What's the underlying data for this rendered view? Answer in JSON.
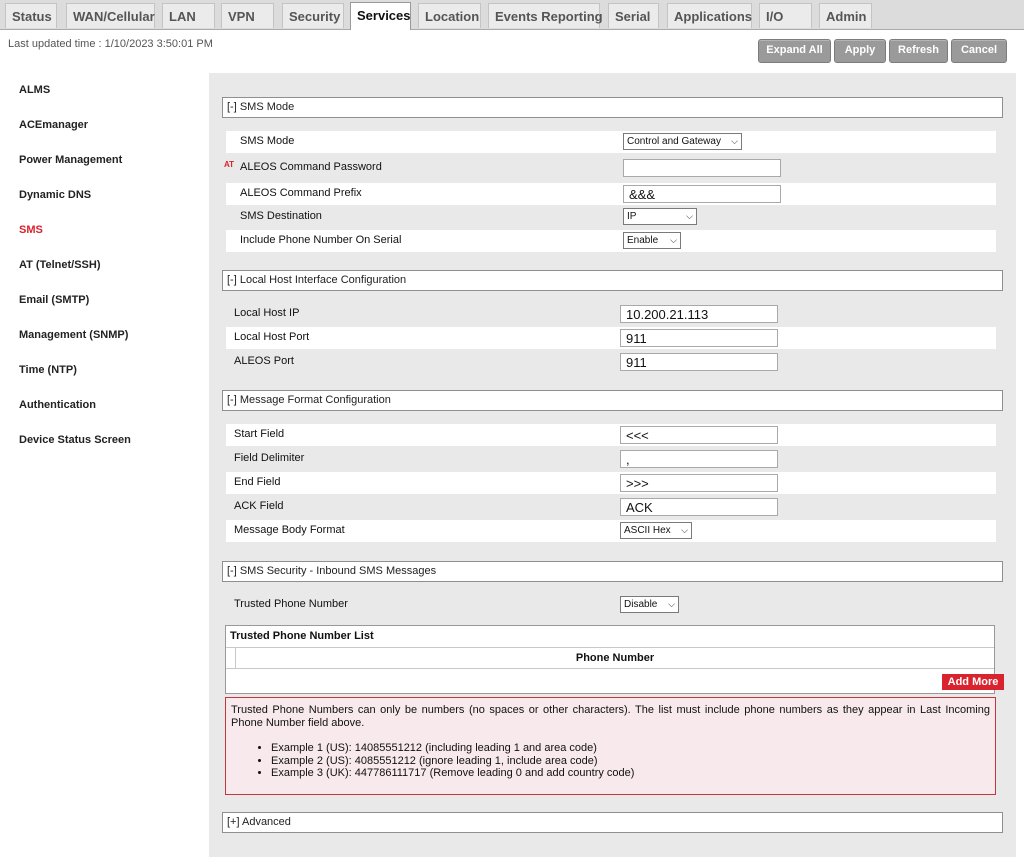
{
  "tabs": [
    {
      "label": "Status"
    },
    {
      "label": "WAN/Cellular"
    },
    {
      "label": "LAN"
    },
    {
      "label": "VPN"
    },
    {
      "label": "Security"
    },
    {
      "label": "Services"
    },
    {
      "label": "Location"
    },
    {
      "label": "Events Reporting"
    },
    {
      "label": "Serial"
    },
    {
      "label": "Applications"
    },
    {
      "label": "I/O"
    },
    {
      "label": "Admin"
    }
  ],
  "active_tab": "Services",
  "last_updated": "Last updated time : 1/10/2023 3:50:01 PM",
  "toolbar": {
    "expand_all": "Expand All",
    "apply": "Apply",
    "refresh": "Refresh",
    "cancel": "Cancel"
  },
  "sidebar": {
    "items": [
      {
        "label": "ALMS"
      },
      {
        "label": "ACEmanager"
      },
      {
        "label": "Power Management"
      },
      {
        "label": "Dynamic DNS"
      },
      {
        "label": "SMS"
      },
      {
        "label": "AT (Telnet/SSH)"
      },
      {
        "label": "Email (SMTP)"
      },
      {
        "label": "Management (SNMP)"
      },
      {
        "label": "Time (NTP)"
      },
      {
        "label": "Authentication"
      },
      {
        "label": "Device Status Screen"
      }
    ],
    "active": "SMS"
  },
  "sms_mode": {
    "header": "[-] SMS Mode",
    "at_marker": "AT",
    "rows": [
      {
        "label": "SMS Mode",
        "value": "Control and Gateway"
      },
      {
        "label": "ALEOS Command Password",
        "value": ""
      },
      {
        "label": "ALEOS Command Prefix",
        "value": "&&&"
      },
      {
        "label": "SMS Destination",
        "value": "IP"
      },
      {
        "label": "Include Phone Number On Serial",
        "value": "Enable"
      }
    ]
  },
  "local_host": {
    "header": "[-] Local Host Interface Configuration",
    "rows": [
      {
        "label": "Local Host IP",
        "value": "10.200.21.113"
      },
      {
        "label": "Local Host Port",
        "value": "911"
      },
      {
        "label": "ALEOS Port",
        "value": "911"
      }
    ]
  },
  "message_format": {
    "header": "[-] Message Format Configuration",
    "rows": [
      {
        "label": "Start Field",
        "value": "<<<"
      },
      {
        "label": "Field Delimiter",
        "value": ","
      },
      {
        "label": "End Field",
        "value": ">>>"
      },
      {
        "label": "ACK Field",
        "value": "ACK"
      },
      {
        "label": "Message Body Format",
        "value": "ASCII Hex"
      }
    ]
  },
  "sms_security": {
    "header": "[-] SMS Security - Inbound SMS Messages",
    "trusted_label": "Trusted Phone Number",
    "trusted_value": "Disable",
    "list_title": "Trusted Phone Number List",
    "column": "Phone Number",
    "add_more": "Add More",
    "note_text": "Trusted Phone Numbers can only be numbers (no spaces or other characters). The list must include phone numbers as they appear in Last Incoming Phone Number field above.",
    "examples": [
      "Example 1 (US): 14085551212 (including leading 1 and area code)",
      "Example 2 (US): 4085551212 (ignore leading 1, include area code)",
      "Example 3 (UK): 447786111717 (Remove leading 0 and add country code)"
    ]
  },
  "advanced": {
    "header": "[+] Advanced"
  },
  "colors": {
    "accent_red": "#d9232e",
    "button_gray": "#9a9a9a",
    "panel_bg": "#e9e9e9",
    "note_bg": "#f8e9ec"
  },
  "icons": {
    "dropdown": "chevron-down-icon"
  }
}
